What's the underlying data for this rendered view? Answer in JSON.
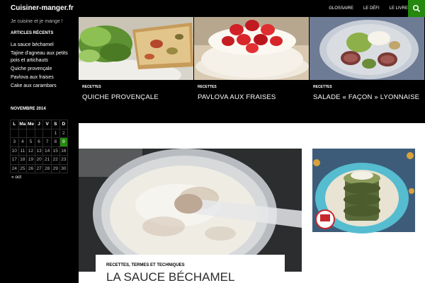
{
  "header": {
    "site_title": "Cuisiner-manger.fr",
    "nav": [
      "GLOSSAIRE",
      "LE DÉFI",
      "LE LIVRE"
    ],
    "accent_color": "#24890d"
  },
  "sidebar": {
    "tagline": "Je cuisine et je mange !",
    "recent_title": "ARTICLES RÉCENTS",
    "recent_posts": [
      "La sauce béchamel",
      "Tajine d'agneau aux petits pois et artichauts",
      "Quiche provençale",
      "Pavlova aux fraises",
      "Cake aux carambars"
    ],
    "calendar_title": "NOVEMBRE 2014",
    "calendar_days": [
      "L",
      "Ma",
      "Me",
      "J",
      "V",
      "S",
      "D"
    ],
    "calendar_rows": [
      [
        "",
        "",
        "",
        "",
        "",
        "1",
        "2"
      ],
      [
        "3",
        "4",
        "5",
        "6",
        "7",
        "8",
        "9"
      ],
      [
        "10",
        "11",
        "12",
        "13",
        "14",
        "15",
        "16"
      ],
      [
        "17",
        "18",
        "19",
        "20",
        "21",
        "22",
        "23"
      ],
      [
        "24",
        "25",
        "26",
        "27",
        "28",
        "29",
        "30"
      ]
    ],
    "calendar_active_day": "9",
    "calendar_prev": "« oct"
  },
  "featured": [
    {
      "category": "RECETTES",
      "title": "QUICHE PROVENÇALE"
    },
    {
      "category": "RECETTES",
      "title": "PAVLOVA AUX FRAISES"
    },
    {
      "category": "RECETTES",
      "title": "SALADE « FAÇON » LYONNAISE"
    }
  ],
  "post": {
    "category": "RECETTES, TERMES ET TECHNIQUES",
    "title": "LA SAUCE BÉCHAMEL"
  }
}
